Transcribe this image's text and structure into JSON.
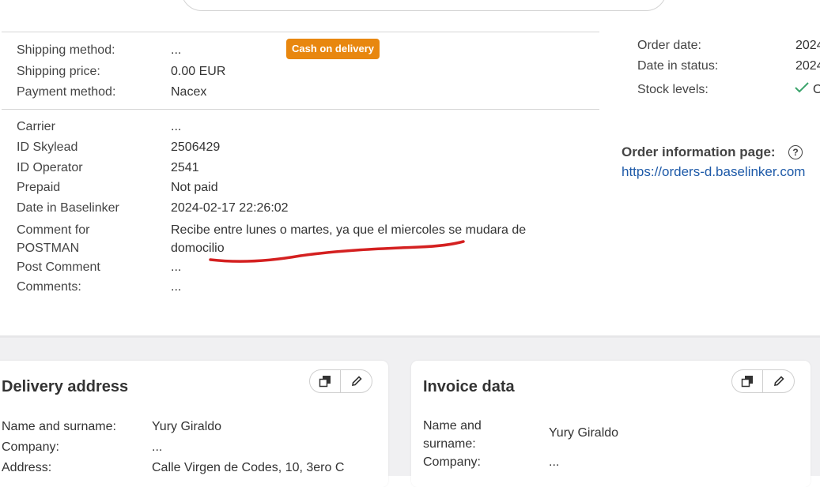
{
  "badge": {
    "cash_on_delivery": "Cash on delivery"
  },
  "shipping": [
    {
      "label": "Shipping method:",
      "value": "..."
    },
    {
      "label": "Shipping price:",
      "value": "0.00 EUR"
    },
    {
      "label": "Payment method:",
      "value": "Nacex"
    }
  ],
  "details": [
    {
      "label": "Carrier",
      "value": "..."
    },
    {
      "label": "ID Skylead",
      "value": "2506429"
    },
    {
      "label": "ID Operator",
      "value": "2541"
    },
    {
      "label": "Prepaid",
      "value": "Not paid"
    },
    {
      "label": "Date in Baselinker",
      "value": "2024-02-17 22:26:02"
    },
    {
      "label": "Comment for POSTMAN",
      "value": "Recibe entre lunes o martes, ya que el miercoles se mudara de domocilio"
    },
    {
      "label": "Post Comment",
      "value": "..."
    },
    {
      "label": "Comments:",
      "value": "..."
    }
  ],
  "right_panel": {
    "order_date_label": "Order date:",
    "order_date_value": "2024",
    "date_in_status_label": "Date in status:",
    "date_in_status_value": "2024",
    "stock_levels_label": "Stock levels:",
    "stock_levels_value": "O",
    "order_info_title": "Order information page:",
    "help_glyph": "?",
    "order_info_link": "https://orders-d.baselinker.com"
  },
  "delivery_card": {
    "title": "Delivery address",
    "rows": [
      {
        "label": "Name and surname:",
        "value": "Yury Giraldo"
      },
      {
        "label": "Company:",
        "value": "..."
      },
      {
        "label": "Address:",
        "value": "Calle Virgen de Codes, 10, 3ero C"
      }
    ]
  },
  "invoice_card": {
    "title": "Invoice data",
    "rows": [
      {
        "label": "Name and surname:",
        "value": "Yury Giraldo"
      },
      {
        "label": "Company:",
        "value": "..."
      }
    ]
  },
  "colors": {
    "badge": "#e8870f",
    "link": "#1e5aa8",
    "check": "#3aa36b",
    "annotation": "#d42020",
    "bottom_bg": "#f0f0f2"
  },
  "icons": {
    "check": "check-icon",
    "help": "help-circle-icon",
    "copy": "copy-icon",
    "edit": "pencil-icon"
  }
}
